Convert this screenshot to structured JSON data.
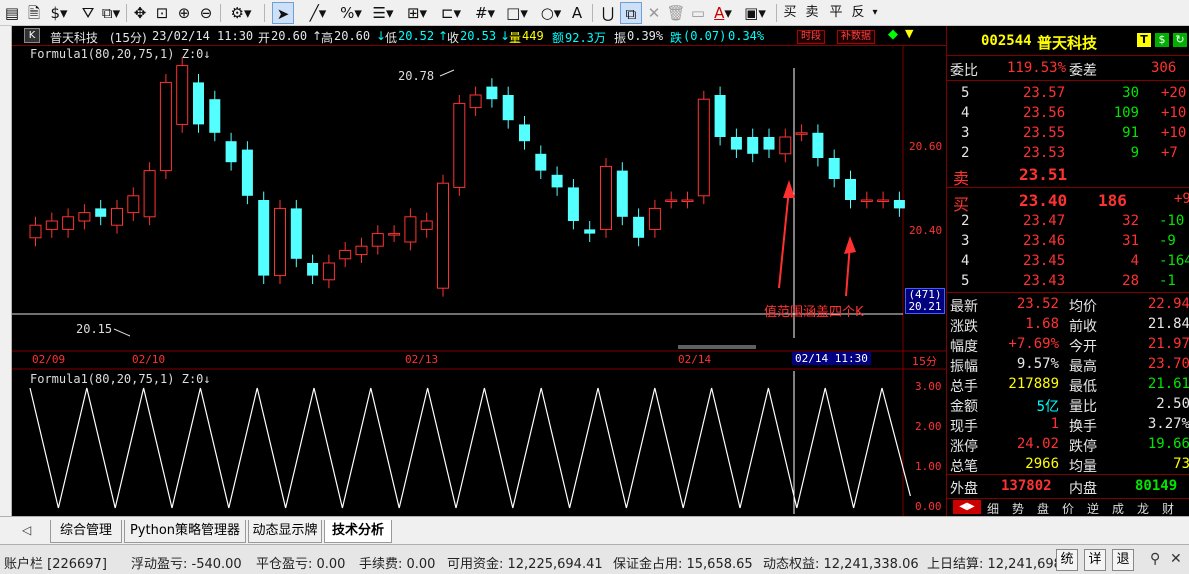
{
  "toolbar": {
    "trade_buttons": [
      "买",
      "卖",
      "平",
      "反"
    ]
  },
  "chart_header": {
    "k_badge": "K",
    "stock": "普天科技",
    "period": "(15分)",
    "datetime": "23/02/14 11:30",
    "open_label": "开",
    "open": "20.60",
    "high_label": "高",
    "high": "20.60",
    "low_label": "低",
    "low": "20.52",
    "close_label": "收",
    "close": "20.53",
    "vol_label": "量",
    "vol": "449",
    "amount_label": "额",
    "amount": "92.3万",
    "amp_label": "振",
    "amp": "0.39%",
    "chg_label": "跌",
    "chg": "(0.07)",
    "chg_pct": "0.34%",
    "btn_period": "时段",
    "btn_fill": "补数据"
  },
  "formula_main": "Formula1(80,20,75,1)  Z:0↓",
  "formula_sub": "Formula1(80,20,75,1)  Z:0↓",
  "annotations": {
    "high_mark": "20.78",
    "low_mark": "20.15",
    "note": "值范围涵盖四个K"
  },
  "price_axis": [
    "20.60",
    "20.40"
  ],
  "price_box_top": "(471)",
  "price_box_bottom": "20.21",
  "date_axis": [
    "02/09",
    "02/10",
    "02/13",
    "02/14"
  ],
  "date_axis_current": "02/14 11:30",
  "period_label": "15分",
  "sub_axis": [
    "3.00",
    "2.00",
    "1.00",
    "0.00"
  ],
  "colors": {
    "up": "#ff3232",
    "down": "#54ffff",
    "bg": "#000000",
    "grid": "#800000"
  },
  "chart_data": {
    "type": "candlestick",
    "candles": [
      {
        "o": 20.36,
        "c": 20.39
      },
      {
        "o": 20.38,
        "c": 20.4
      },
      {
        "o": 20.38,
        "c": 20.41
      },
      {
        "o": 20.4,
        "c": 20.42
      },
      {
        "o": 20.43,
        "c": 20.41
      },
      {
        "o": 20.39,
        "c": 20.43
      },
      {
        "o": 20.42,
        "c": 20.46
      },
      {
        "o": 20.41,
        "c": 20.52
      },
      {
        "o": 20.52,
        "c": 20.73
      },
      {
        "o": 20.63,
        "c": 20.77
      },
      {
        "o": 20.73,
        "c": 20.63
      },
      {
        "o": 20.69,
        "c": 20.61
      },
      {
        "o": 20.59,
        "c": 20.54
      },
      {
        "o": 20.57,
        "c": 20.46
      },
      {
        "o": 20.45,
        "c": 20.27
      },
      {
        "o": 20.27,
        "c": 20.43
      },
      {
        "o": 20.43,
        "c": 20.31
      },
      {
        "o": 20.3,
        "c": 20.27
      },
      {
        "o": 20.26,
        "c": 20.3
      },
      {
        "o": 20.31,
        "c": 20.33
      },
      {
        "o": 20.32,
        "c": 20.34
      },
      {
        "o": 20.34,
        "c": 20.37
      },
      {
        "o": 20.37,
        "c": 20.37
      },
      {
        "o": 20.35,
        "c": 20.41
      },
      {
        "o": 20.38,
        "c": 20.4
      },
      {
        "o": 20.24,
        "c": 20.49
      },
      {
        "o": 20.48,
        "c": 20.68
      },
      {
        "o": 20.67,
        "c": 20.7
      },
      {
        "o": 20.72,
        "c": 20.69
      },
      {
        "o": 20.7,
        "c": 20.64
      },
      {
        "o": 20.63,
        "c": 20.59
      },
      {
        "o": 20.56,
        "c": 20.52
      },
      {
        "o": 20.51,
        "c": 20.48
      },
      {
        "o": 20.48,
        "c": 20.4
      },
      {
        "o": 20.38,
        "c": 20.37
      },
      {
        "o": 20.38,
        "c": 20.53
      },
      {
        "o": 20.52,
        "c": 20.41
      },
      {
        "o": 20.41,
        "c": 20.36
      },
      {
        "o": 20.38,
        "c": 20.43
      },
      {
        "o": 20.45,
        "c": 20.45
      },
      {
        "o": 20.45,
        "c": 20.45
      },
      {
        "o": 20.46,
        "c": 20.69
      },
      {
        "o": 20.7,
        "c": 20.6
      },
      {
        "o": 20.6,
        "c": 20.57
      },
      {
        "o": 20.6,
        "c": 20.56
      },
      {
        "o": 20.6,
        "c": 20.57
      },
      {
        "o": 20.56,
        "c": 20.6
      },
      {
        "o": 20.61,
        "c": 20.61
      },
      {
        "o": 20.61,
        "c": 20.55
      },
      {
        "o": 20.55,
        "c": 20.5
      },
      {
        "o": 20.5,
        "c": 20.45
      },
      {
        "o": 20.45,
        "c": 20.45
      },
      {
        "o": 20.45,
        "c": 20.45
      },
      {
        "o": 20.45,
        "c": 20.43
      }
    ],
    "sub_series": [
      3,
      0,
      3,
      0,
      3,
      0,
      3,
      0,
      3,
      0,
      3,
      0,
      3,
      0,
      3,
      0,
      3,
      0,
      3,
      0,
      3,
      0,
      3,
      0,
      3,
      0,
      3,
      0,
      3,
      0,
      3,
      0.3
    ]
  },
  "quote": {
    "code": "002544",
    "name": "普天科技",
    "wb_label": "委比",
    "wb": "119.53%",
    "wc_label": "委差",
    "wc": "306",
    "asks": [
      {
        "lvl": "5",
        "price": "23.57",
        "vol": "30",
        "chg": "+20"
      },
      {
        "lvl": "4",
        "price": "23.56",
        "vol": "109",
        "chg": "+10"
      },
      {
        "lvl": "3",
        "price": "23.55",
        "vol": "91",
        "chg": "+10"
      },
      {
        "lvl": "2",
        "price": "23.53",
        "vol": "9",
        "chg": "+7"
      }
    ],
    "sell1_label": "卖",
    "sell1_price": "23.51",
    "buy1_label": "买",
    "buy1_price": "23.40",
    "buy1_vol": "186",
    "buy1_chg": "+9",
    "bids": [
      {
        "lvl": "2",
        "price": "23.47",
        "vol": "32",
        "chg": "-10"
      },
      {
        "lvl": "3",
        "price": "23.46",
        "vol": "31",
        "chg": "-9"
      },
      {
        "lvl": "4",
        "price": "23.45",
        "vol": "4",
        "chg": "-164"
      },
      {
        "lvl": "5",
        "price": "23.43",
        "vol": "28",
        "chg": "-1"
      }
    ],
    "stats": [
      {
        "l1": "最新",
        "v1": "23.52",
        "c1": "red",
        "l2": "均价",
        "v2": "22.94",
        "c2": "red"
      },
      {
        "l1": "涨跌",
        "v1": "1.68",
        "c1": "red",
        "l2": "前收",
        "v2": "21.84",
        "c2": "white"
      },
      {
        "l1": "幅度",
        "v1": "+7.69%",
        "c1": "red",
        "l2": "今开",
        "v2": "21.97",
        "c2": "red"
      },
      {
        "l1": "振幅",
        "v1": "9.57%",
        "c1": "white",
        "l2": "最高",
        "v2": "23.70",
        "c2": "red"
      },
      {
        "l1": "总手",
        "v1": "217889",
        "c1": "yellow",
        "l2": "最低",
        "v2": "21.61",
        "c2": "green"
      },
      {
        "l1": "金额",
        "v1": "5亿",
        "c1": "cyan",
        "l2": "量比",
        "v2": "2.50",
        "c2": "white"
      },
      {
        "l1": "现手",
        "v1": "1",
        "c1": "red",
        "l2": "换手",
        "v2": "3.27%",
        "c2": "white"
      },
      {
        "l1": "涨停",
        "v1": "24.02",
        "c1": "red",
        "l2": "跌停",
        "v2": "19.66",
        "c2": "green"
      },
      {
        "l1": "总笔",
        "v1": "2966",
        "c1": "yellow",
        "l2": "均量",
        "v2": "73",
        "c2": "yellow"
      }
    ],
    "outer_label": "外盘",
    "outer": "137802",
    "inner_label": "内盘",
    "inner": "80149",
    "bottom_tabs": [
      "细",
      "势",
      "盘",
      "价",
      "逆",
      "成",
      "龙",
      "财"
    ]
  },
  "tabs": [
    "综合管理",
    "Python策略管理器",
    "动态显示牌",
    "技术分析"
  ],
  "status": {
    "account": "账户栏 [226697]",
    "float_pl": "浮动盈亏: -540.00",
    "close_pl": "平仓盈亏: 0.00",
    "fee": "手续费: 0.00",
    "avail": "可用资金: 12,225,694.41",
    "margin": "保证金占用: 15,658.65",
    "equity": "动态权益: 12,241,338.06",
    "settle": "上日结算: 12,241,698",
    "buttons": [
      "统",
      "详",
      "退"
    ]
  }
}
